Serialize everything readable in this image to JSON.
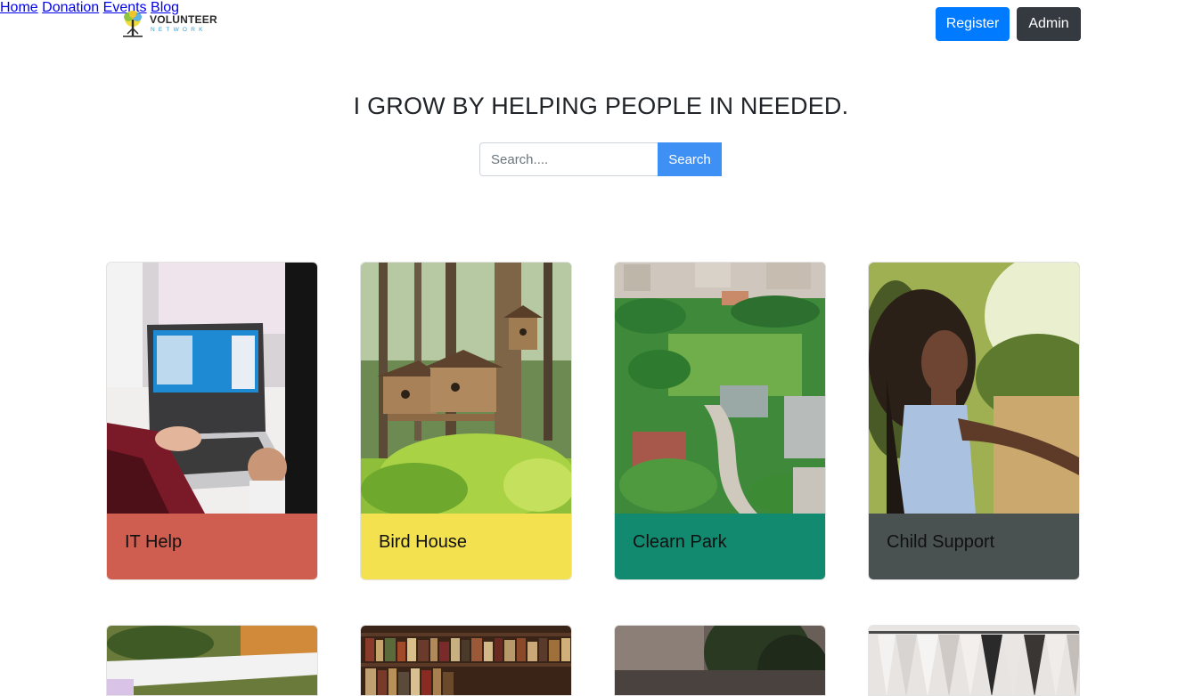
{
  "brand": {
    "name_line1": "VOLUNTEER",
    "name_line2": "NETWORK"
  },
  "nav": {
    "items": [
      "Home",
      "Donation",
      "Events",
      "Blog"
    ],
    "register": "Register",
    "admin": "Admin"
  },
  "hero": {
    "title": "I GROW BY HELPING PEOPLE IN NEEDED."
  },
  "search": {
    "placeholder": "Search....",
    "button": "Search"
  },
  "cards": [
    {
      "title": "IT Help",
      "color": "#cf5d50"
    },
    {
      "title": "Bird House",
      "color": "#f3e150"
    },
    {
      "title": "Clearn Park",
      "color": "#128a6f"
    },
    {
      "title": "Child Support",
      "color": "#4a5151"
    }
  ]
}
